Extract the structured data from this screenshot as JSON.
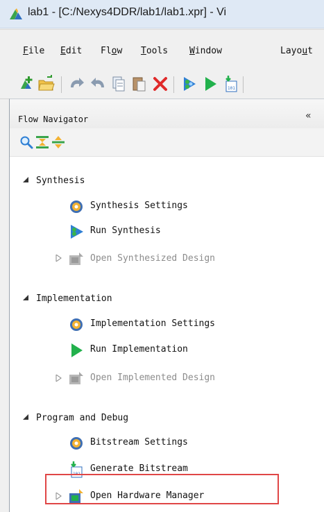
{
  "window": {
    "title": "lab1 - [C:/Nexys4DDR/lab1/lab1.xpr] - Vi"
  },
  "menu": [
    {
      "mnemonic": "F",
      "rest": "ile"
    },
    {
      "mnemonic": "E",
      "rest": "dit"
    },
    {
      "pre": "Fl",
      "mnemonic": "o",
      "rest": "w"
    },
    {
      "mnemonic": "T",
      "rest": "ools"
    },
    {
      "mnemonic": "W",
      "rest": "indow"
    },
    {
      "pre": "Layo",
      "mnemonic": "u",
      "rest": "t"
    }
  ],
  "toolbar": {
    "icons": [
      "new-project-icon",
      "open-project-icon",
      "undo-icon",
      "redo-icon",
      "copy-icon",
      "paste-icon",
      "delete-icon",
      "run-synthesis-icon",
      "run-implementation-icon",
      "generate-bitstream-icon"
    ]
  },
  "flow_navigator": {
    "title": "Flow Navigator",
    "collapse_glyph": "«",
    "tools": [
      "search-icon",
      "collapse-all-icon",
      "expand-all-icon"
    ],
    "sections": [
      {
        "label": "Synthesis",
        "items": [
          {
            "label": "Synthesis Settings",
            "icon": "settings-gear-icon",
            "enabled": true
          },
          {
            "label": "Run Synthesis",
            "icon": "run-synthesis-icon",
            "enabled": true
          },
          {
            "label": "Open Synthesized Design",
            "icon": "open-design-icon",
            "enabled": false
          }
        ]
      },
      {
        "label": "Implementation",
        "items": [
          {
            "label": "Implementation Settings",
            "icon": "settings-gear-icon",
            "enabled": true
          },
          {
            "label": "Run Implementation",
            "icon": "play-icon",
            "enabled": true
          },
          {
            "label": "Open Implemented Design",
            "icon": "open-design-icon",
            "enabled": false
          }
        ]
      },
      {
        "label": "Program and Debug",
        "items": [
          {
            "label": "Bitstream Settings",
            "icon": "settings-gear-icon",
            "enabled": true
          },
          {
            "label": "Generate Bitstream",
            "icon": "generate-bitstream-icon",
            "enabled": true,
            "highlighted": true
          },
          {
            "label": "Open Hardware Manager",
            "icon": "hardware-manager-icon",
            "enabled": true
          }
        ]
      }
    ]
  },
  "colors": {
    "highlight_border": "#e04646",
    "play_green": "#22b14c",
    "disabled_text": "#8c8c8c"
  }
}
